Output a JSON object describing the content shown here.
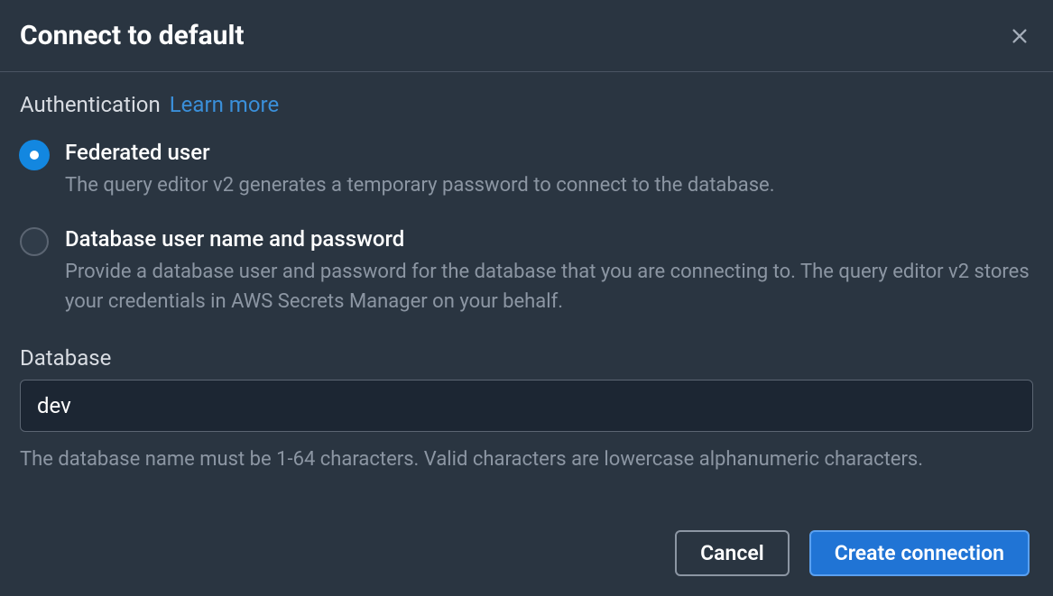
{
  "dialog": {
    "title": "Connect to default"
  },
  "auth": {
    "label": "Authentication",
    "learn_more": "Learn more",
    "options": [
      {
        "label": "Federated user",
        "description": "The query editor v2 generates a temporary password to connect to the database.",
        "selected": true
      },
      {
        "label": "Database user name and password",
        "description": "Provide a database user and password for the database that you are connecting to. The query editor v2 stores your credentials in AWS Secrets Manager on your behalf.",
        "selected": false
      }
    ]
  },
  "database": {
    "label": "Database",
    "value": "dev",
    "hint": "The database name must be 1-64 characters. Valid characters are lowercase alphanumeric characters."
  },
  "footer": {
    "cancel": "Cancel",
    "submit": "Create connection"
  }
}
